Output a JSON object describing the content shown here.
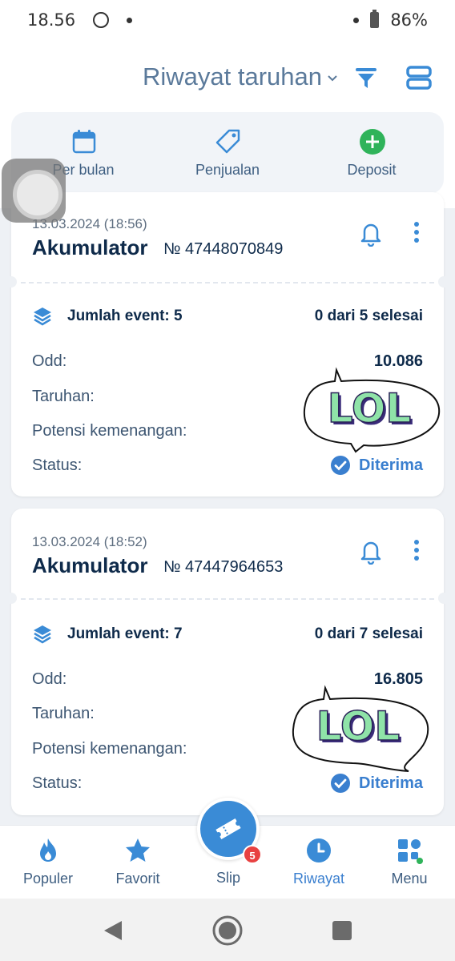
{
  "status_bar": {
    "time": "18.56",
    "battery": "86%"
  },
  "header": {
    "title": "Riwayat taruhan"
  },
  "quick_actions": [
    {
      "label": "Per bulan",
      "icon": "calendar-icon"
    },
    {
      "label": "Penjualan",
      "icon": "tag-icon"
    },
    {
      "label": "Deposit",
      "icon": "plus-circle-icon"
    }
  ],
  "bets": [
    {
      "date": "13.03.2024 (18:56)",
      "type": "Akumulator",
      "number": "№ 47448070849",
      "events_label": "Jumlah event: 5",
      "progress": "0 dari 5 selesai",
      "odd_label": "Odd:",
      "odd_value": "10.086",
      "stake_label": "Taruhan:",
      "potential_label": "Potensi kemenangan:",
      "status_label": "Status:",
      "status_value": "Diterima",
      "sticker_text": "LOL"
    },
    {
      "date": "13.03.2024 (18:52)",
      "type": "Akumulator",
      "number": "№ 47447964653",
      "events_label": "Jumlah event: 7",
      "progress": "0 dari 7 selesai",
      "odd_label": "Odd:",
      "odd_value": "16.805",
      "stake_label": "Taruhan:",
      "potential_label": "Potensi kemenangan:",
      "status_label": "Status:",
      "status_value": "Diterima",
      "sticker_text": "LOL"
    }
  ],
  "bottom_nav": [
    {
      "label": "Populer",
      "icon": "flame-icon"
    },
    {
      "label": "Favorit",
      "icon": "star-icon"
    },
    {
      "label": "Slip",
      "icon": "ticket-icon",
      "badge": "5"
    },
    {
      "label": "Riwayat",
      "icon": "clock-icon",
      "active": true
    },
    {
      "label": "Menu",
      "icon": "grid-icon"
    }
  ],
  "colors": {
    "accent": "#3a8bd6",
    "navy": "#0e2a4a",
    "badge": "#e84141",
    "deposit_green": "#2fb35a"
  }
}
